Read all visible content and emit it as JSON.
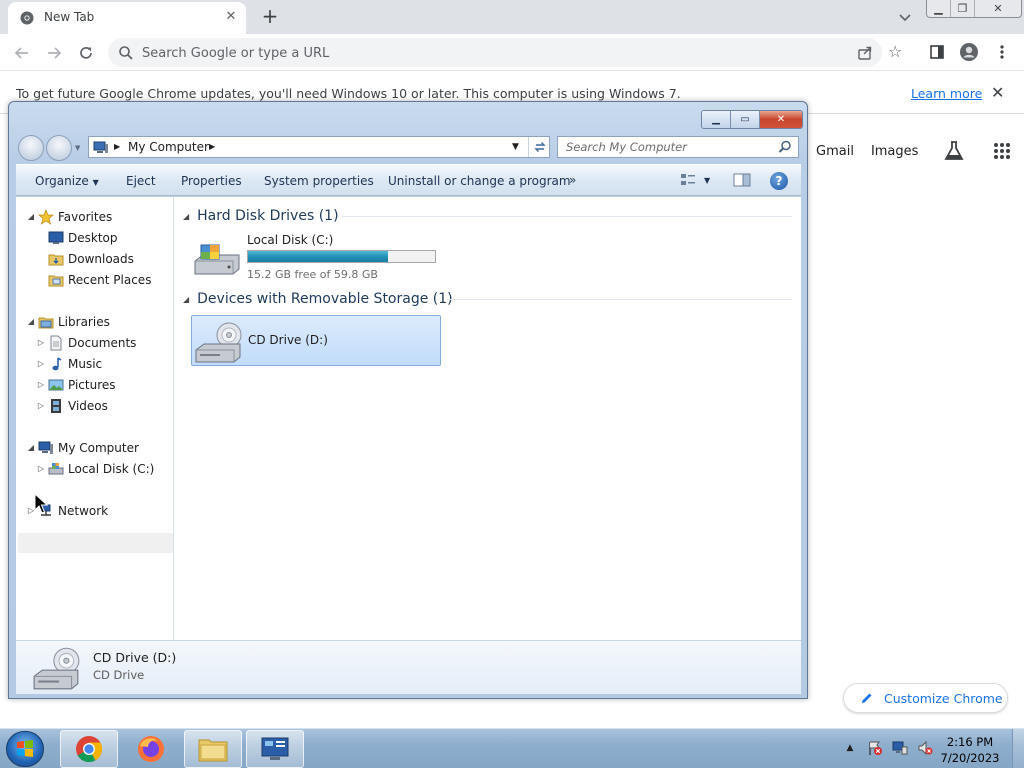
{
  "chrome": {
    "tab": {
      "title": "New Tab"
    },
    "omnibox": {
      "placeholder": "Search Google or type a URL"
    },
    "infobar": {
      "message": "To get future Google Chrome updates, you'll need Windows 10 or later. This computer is using Windows 7.",
      "link": "Learn more"
    },
    "ntp": {
      "links": [
        "Gmail",
        "Images"
      ],
      "customize_label": "Customize Chrome"
    },
    "colors": {
      "link": "#1a73e8",
      "tabbar": "#dee1e6"
    }
  },
  "explorer": {
    "address": {
      "location": "My Computer"
    },
    "search": {
      "placeholder": "Search My Computer"
    },
    "commands": [
      "Organize",
      "Eject",
      "Properties",
      "System properties",
      "Uninstall or change a program"
    ],
    "nav": {
      "favorites": "Favorites",
      "favorites_items": [
        "Desktop",
        "Downloads",
        "Recent Places"
      ],
      "libraries": "Libraries",
      "libraries_items": [
        "Documents",
        "Music",
        "Pictures",
        "Videos"
      ],
      "computer": "My Computer",
      "computer_items": [
        "Local Disk (C:)"
      ],
      "network": "Network"
    },
    "groups": {
      "hdd": "Hard Disk Drives (1)",
      "removable": "Devices with Removable Storage (1)"
    },
    "drive_c": {
      "name": "Local Disk (C:)",
      "free_text": "15.2 GB free of 59.8 GB",
      "used_fraction": 0.746
    },
    "drive_d": {
      "name": "CD Drive (D:)"
    },
    "details": {
      "name": "CD Drive (D:)",
      "type": "CD Drive"
    }
  },
  "taskbar": {
    "clock_time": "2:16 PM",
    "clock_date": "7/20/2023"
  }
}
